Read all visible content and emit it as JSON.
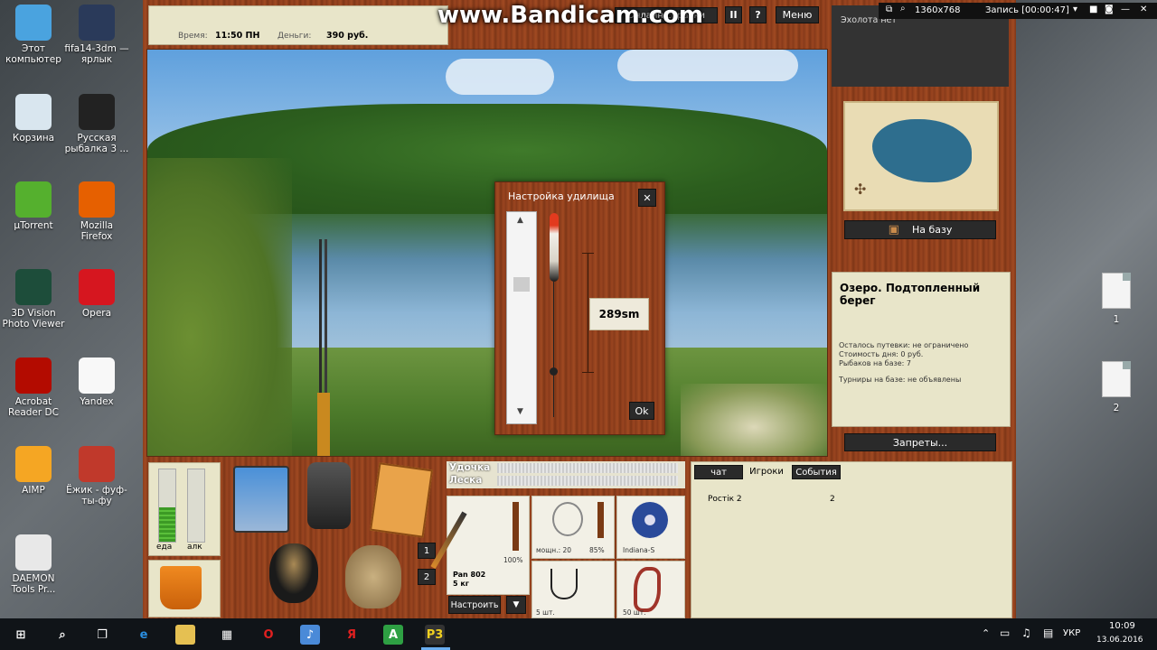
{
  "desktop_left": [
    {
      "label": "Этот компьютер",
      "icon": "computer-icon",
      "color": "#4aa3df"
    },
    {
      "label": "fifa14-3dm — ярлык",
      "icon": "fifa-shortcut-icon",
      "color": "#2a3a5a"
    },
    {
      "label": "Корзина",
      "icon": "recycle-bin-icon",
      "color": "#d9e6ef"
    },
    {
      "label": "Русская рыбалка 3 ...",
      "icon": "russian-fishing-icon",
      "color": "#222"
    },
    {
      "label": "µTorrent",
      "icon": "utorrent-icon",
      "color": "#55b02e"
    },
    {
      "label": "Mozilla Firefox",
      "icon": "firefox-icon",
      "color": "#e66000"
    },
    {
      "label": "3D Vision Photo Viewer",
      "icon": "3d-vision-icon",
      "color": "#1d4d3a"
    },
    {
      "label": "Opera",
      "icon": "opera-icon",
      "color": "#d6161f"
    },
    {
      "label": "Acrobat Reader DC",
      "icon": "acrobat-icon",
      "color": "#b30b00"
    },
    {
      "label": "Yandex",
      "icon": "yandex-icon",
      "color": "#f8f8f8"
    },
    {
      "label": "AIMP",
      "icon": "aimp-icon",
      "color": "#f5a623"
    },
    {
      "label": "Ёжик - фуф-ты-фу",
      "icon": "mp3-file-icon",
      "color": "#c0392b"
    },
    {
      "label": "DAEMON Tools Pr...",
      "icon": "daemon-tools-icon",
      "color": "#e8e8e8"
    }
  ],
  "desktop_right": [
    {
      "label": "1",
      "icon": "text-file-icon"
    },
    {
      "label": "2",
      "icon": "text-file-icon"
    }
  ],
  "watermark": "www.Bandicam.com",
  "bandicam": {
    "resolution": "1360x768",
    "record_label": "Запись [00:00:47]"
  },
  "game": {
    "time_label": "Время:",
    "time_value": "11:50 ПН",
    "money_label": "Деньги:",
    "money_value": "390 руб.",
    "top_tab": "Онлайн справки",
    "pause": "II",
    "help": "?",
    "menu": "Меню",
    "sonar": "Эхолота нет",
    "to_base": "На базу",
    "location_title": "Озеро. Подтопленный берег",
    "location_info": [
      "Осталось путевки: не ограничено",
      "Стоимость дня: 0 руб.",
      "Рыбаков на базе: 7",
      "Турниры на базе: не объявлены"
    ],
    "bans": "Запреты...",
    "dialog": {
      "title": "Настройка удилища",
      "close": "✕",
      "depth": "289sm",
      "ok": "Ok"
    },
    "stats": {
      "food": "еда",
      "alc": "алк"
    },
    "slots": {
      "one": "1",
      "two": "2"
    },
    "rod_label": "Удочка",
    "line_label": "Леска",
    "rod": {
      "name": "Pan 802",
      "weight": "5 кг",
      "percent": "100%"
    },
    "reel": {
      "power": "мощн.: 20",
      "percent": "85%"
    },
    "line_item": "Indiana-S",
    "hook_count": "5 шт.",
    "bait_count": "50 шт.",
    "configure": "Настроить",
    "arrow": "▼",
    "tabs": [
      "чат",
      "Игроки",
      "События"
    ],
    "players": [
      {
        "name": "Ростік 2",
        "value": "2"
      }
    ]
  },
  "taskbar": {
    "lang": "УКР",
    "time": "10:09",
    "date": "13.06.2016"
  }
}
